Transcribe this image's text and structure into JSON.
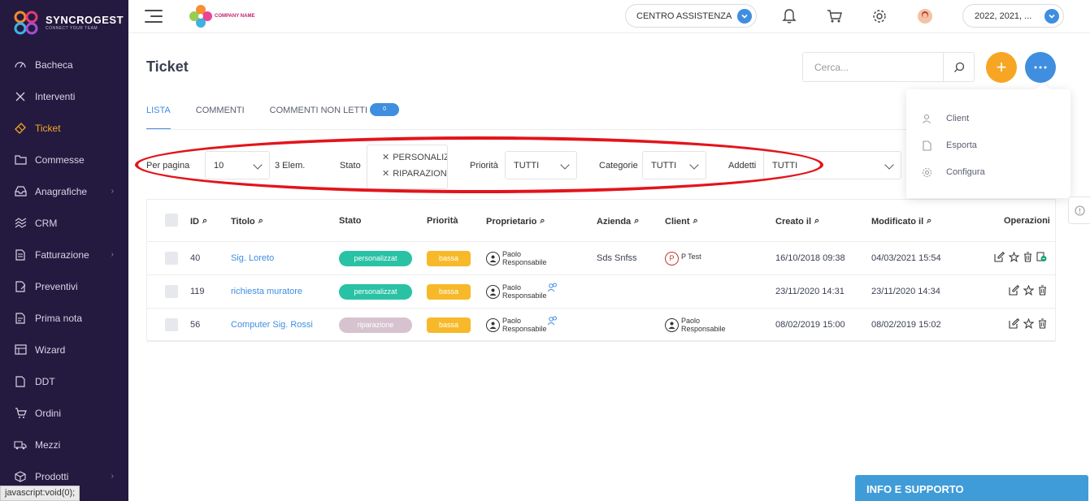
{
  "brand": {
    "title": "SYNCROGEST",
    "subtitle": "CONNECT YOUR TEAM",
    "company_name": "COMPANY NAME"
  },
  "sidebar": {
    "items": [
      {
        "label": "Bacheca",
        "icon": "dashboard-icon",
        "chevron": false
      },
      {
        "label": "Interventi",
        "icon": "tools-icon",
        "chevron": false
      },
      {
        "label": "Ticket",
        "icon": "ticket-icon",
        "chevron": false,
        "active": true
      },
      {
        "label": "Commesse",
        "icon": "folder-icon",
        "chevron": false
      },
      {
        "label": "Anagrafiche",
        "icon": "inbox-icon",
        "chevron": true
      },
      {
        "label": "CRM",
        "icon": "crm-icon",
        "chevron": false
      },
      {
        "label": "Fatturazione",
        "icon": "invoice-icon",
        "chevron": true
      },
      {
        "label": "Preventivi",
        "icon": "quote-icon",
        "chevron": false
      },
      {
        "label": "Prima nota",
        "icon": "note-icon",
        "chevron": false
      },
      {
        "label": "Wizard",
        "icon": "wizard-icon",
        "chevron": false
      },
      {
        "label": "DDT",
        "icon": "ddt-icon",
        "chevron": false
      },
      {
        "label": "Ordini",
        "icon": "cart-icon",
        "chevron": false
      },
      {
        "label": "Mezzi",
        "icon": "truck-icon",
        "chevron": false
      },
      {
        "label": "Prodotti",
        "icon": "box-icon",
        "chevron": true
      }
    ],
    "active_color": "#f5a623",
    "background": "#241a3f"
  },
  "status_bar": "javascript:void(0);",
  "topbar": {
    "assistance_label": "CENTRO ASSISTENZA",
    "years_label": "2022, 2021, ..."
  },
  "page": {
    "title": "Ticket",
    "search_placeholder": "Cerca...",
    "add_icon": "+",
    "more_icon": "···"
  },
  "tabs": [
    {
      "label": "LISTA",
      "active": true
    },
    {
      "label": "COMMENTI",
      "active": false
    },
    {
      "label": "COMMENTI NON LETTI",
      "active": false,
      "badge": "0"
    }
  ],
  "filters": {
    "per_page_label": "Per pagina",
    "per_page_value": "10",
    "count_label": "3 Elem.",
    "stato_label": "Stato",
    "stato_tags": [
      "PERSONALIZZ",
      "RIPARAZIONE"
    ],
    "priorita_label": "Priorità",
    "priorita_value": "TUTTI",
    "categorie_label": "Categorie",
    "categorie_value": "TUTTI",
    "addetti_label": "Addetti",
    "addetti_value": "TUTTI"
  },
  "table": {
    "headers": {
      "id": "ID",
      "titolo": "Titolo",
      "stato": "Stato",
      "priorita": "Priorità",
      "proprietario": "Proprietario",
      "azienda": "Azienda",
      "client": "Client",
      "creato": "Creato il",
      "modificato": "Modificato il",
      "operazioni": "Operazioni"
    },
    "rows": [
      {
        "id": "40",
        "titolo": "Sig. Loreto",
        "stato": "personalizzat",
        "stato_color": "#29c2a4",
        "priorita": "bassa",
        "proprietario": [
          "Paolo",
          "Responsabile"
        ],
        "azienda": "Sds Snfss",
        "client": "P Test",
        "creato": "16/10/2018 09:38",
        "modificato": "04/03/2021 15:54"
      },
      {
        "id": "119",
        "titolo": "richiesta muratore",
        "stato": "personalizzat",
        "stato_color": "#29c2a4",
        "priorita": "bassa",
        "proprietario": [
          "Paolo",
          "Responsabile"
        ],
        "azienda": "",
        "client": "",
        "creato": "23/11/2020 14:31",
        "modificato": "23/11/2020 14:34"
      },
      {
        "id": "56",
        "titolo": "Computer Sig. Rossi",
        "stato": "riparazione",
        "stato_color": "#d6c3cf",
        "priorita": "bassa",
        "proprietario": [
          "Paolo",
          "Responsabile"
        ],
        "azienda": "",
        "client": [
          "Paolo",
          "Responsabile"
        ],
        "creato": "08/02/2019 15:00",
        "modificato": "08/02/2019 15:02"
      }
    ]
  },
  "dropdown_menu": [
    {
      "label": "Client",
      "icon": "user-icon"
    },
    {
      "label": "Esporta",
      "icon": "file-icon"
    },
    {
      "label": "Configura",
      "icon": "gear-icon"
    }
  ],
  "support_label": "INFO E SUPPORTO",
  "colors": {
    "primary": "#3f8ee0",
    "accent": "#f7a623",
    "priority": "#f7b929",
    "highlight": "#e3141b"
  }
}
